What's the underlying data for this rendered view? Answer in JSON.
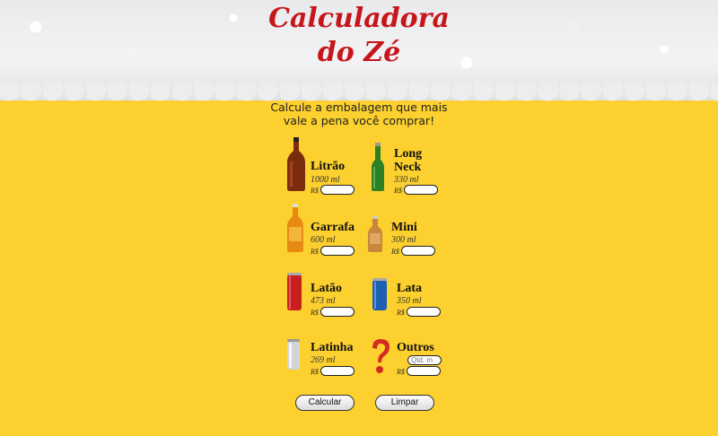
{
  "title": {
    "line1": "Calculadora",
    "line2": "do Zé"
  },
  "subtitle": {
    "line1": "Calcule a embalagem que mais",
    "line2": "vale a pena você comprar!"
  },
  "currency": "R$",
  "items": [
    {
      "name": "Litrão",
      "volume": "1000 ml"
    },
    {
      "name": "Long Neck",
      "volume": "330 ml"
    },
    {
      "name": "Garrafa",
      "volume": "600 ml"
    },
    {
      "name": "Mini",
      "volume": "300 ml"
    },
    {
      "name": "Latão",
      "volume": "473 ml"
    },
    {
      "name": "Lata",
      "volume": "350 ml"
    },
    {
      "name": "Latinha",
      "volume": "269 ml"
    },
    {
      "name": "Outros",
      "volume": "",
      "qty_placeholder": "Qtd. m"
    }
  ],
  "buttons": {
    "calc": "Calcular",
    "clear": "Limpar"
  },
  "colors": {
    "title": "#c6161b",
    "background": "#fcd02e"
  }
}
